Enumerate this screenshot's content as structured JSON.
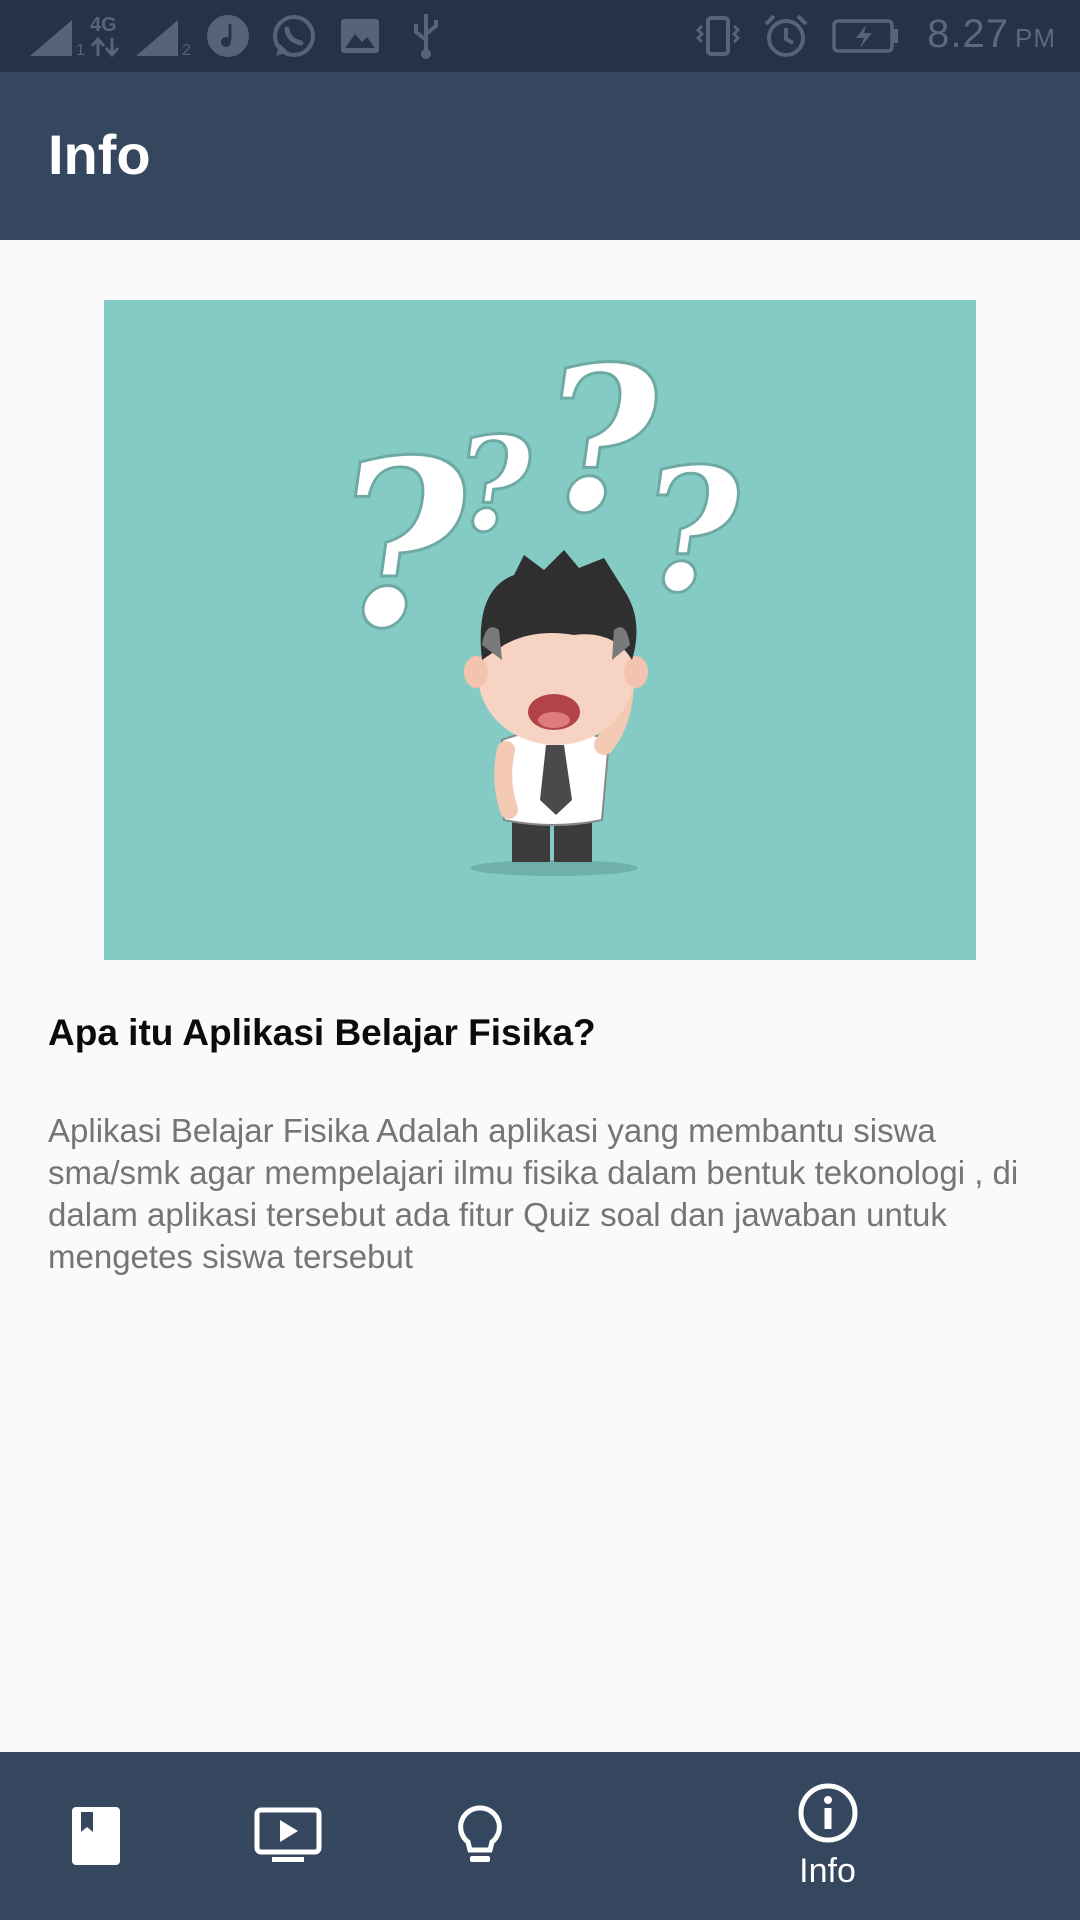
{
  "status_bar": {
    "network_label": "4G",
    "sim1": "1",
    "sim2": "2",
    "time": "8.27",
    "ampm": "PM",
    "icons": [
      "signal-icon",
      "signal-icon",
      "music-icon",
      "whatsapp-icon",
      "image-icon",
      "usb-icon",
      "vibrate-icon",
      "alarm-icon",
      "battery-charging-icon"
    ]
  },
  "app_bar": {
    "title": "Info"
  },
  "content": {
    "heading": "Apa itu Aplikasi Belajar Fisika?",
    "description": "Aplikasi Belajar Fisika Adalah aplikasi yang membantu siswa sma/smk agar mempelajari ilmu fisika dalam bentuk tekonologi , di dalam aplikasi tersebut ada fitur Quiz soal dan jawaban untuk mengetes siswa tersebut",
    "illustration": "confused-student-illustration"
  },
  "bottom_nav": {
    "items": [
      {
        "icon": "book-icon",
        "label": ""
      },
      {
        "icon": "video-icon",
        "label": ""
      },
      {
        "icon": "lightbulb-icon",
        "label": ""
      },
      {
        "icon": "info-icon",
        "label": "Info",
        "active": true
      }
    ]
  },
  "colors": {
    "status_bar": "#243349",
    "primary": "#34475f",
    "background": "#fafafa",
    "illustration_bg": "#84cbc5",
    "body_text": "#757575"
  }
}
